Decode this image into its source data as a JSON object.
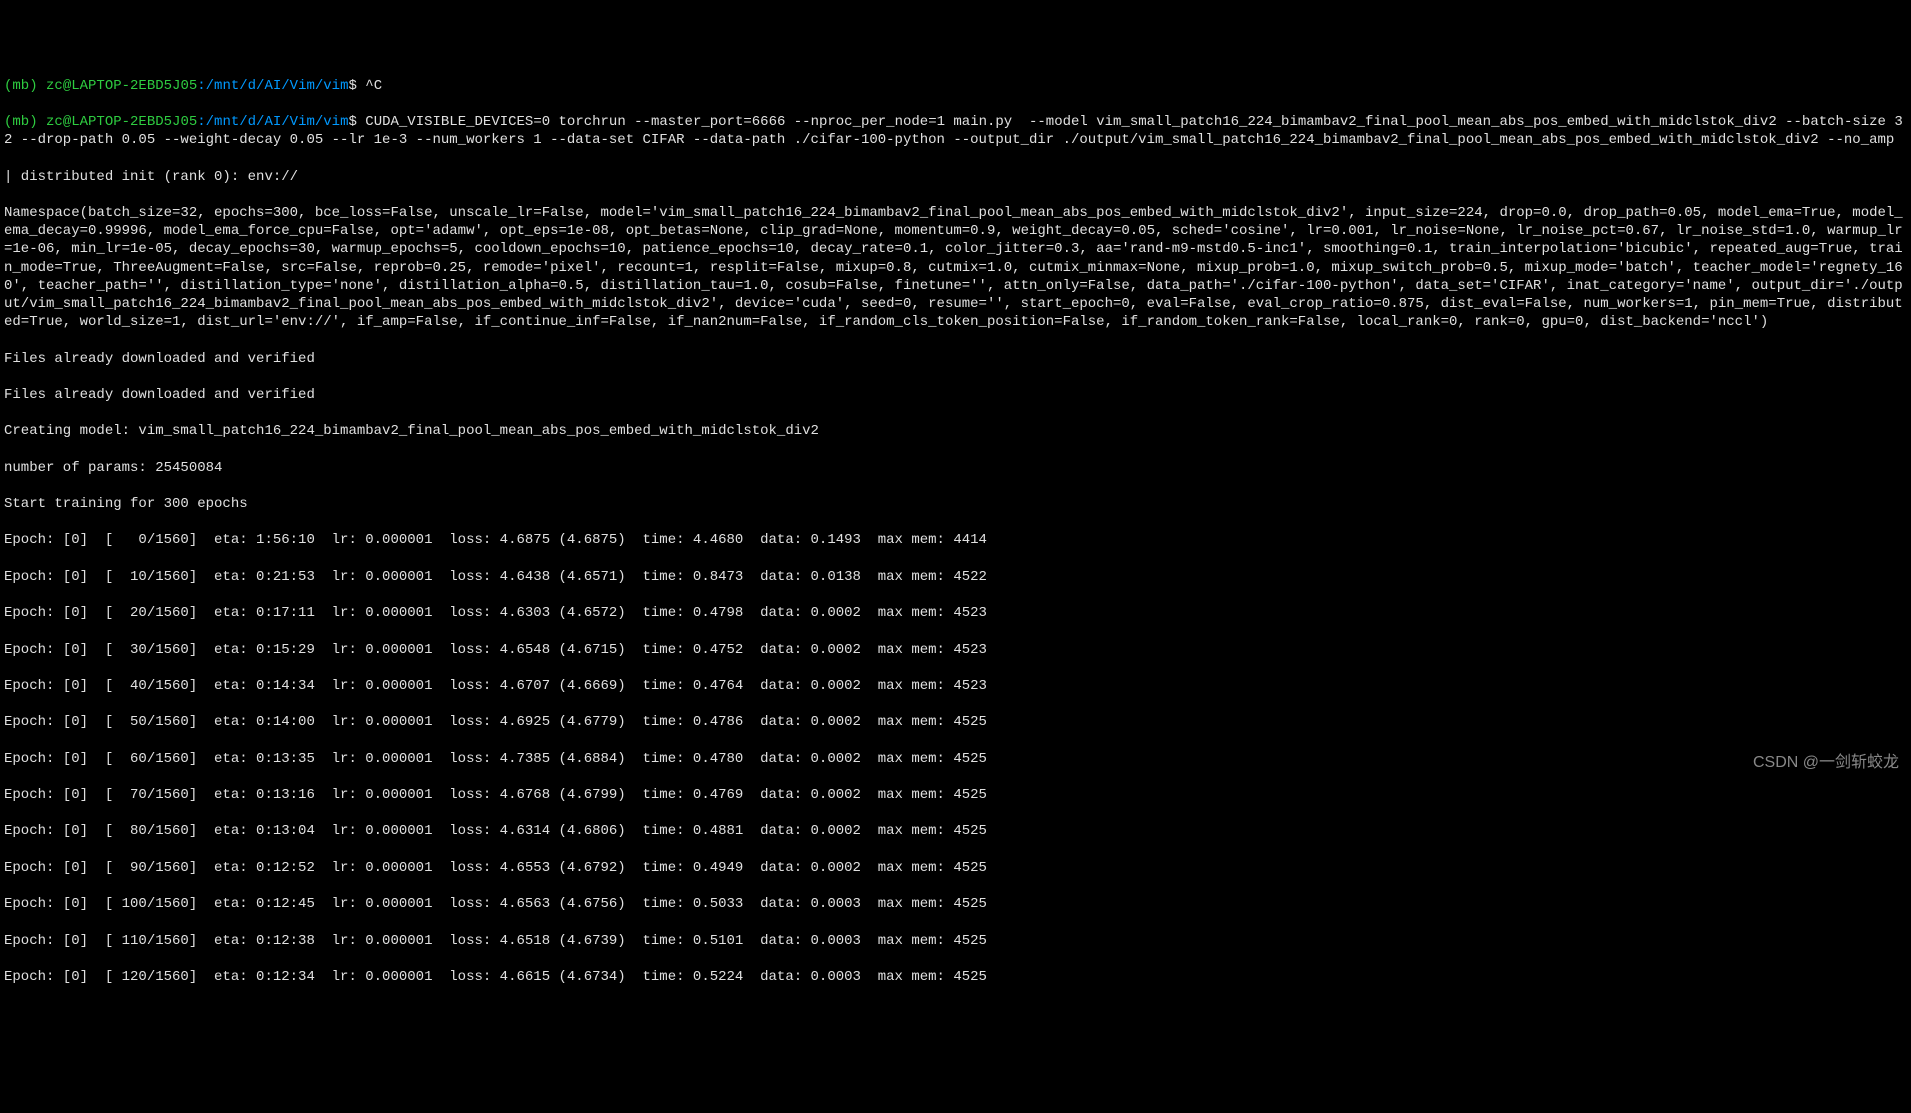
{
  "prompt1": {
    "env": "(mb)",
    "user": "zc@LAPTOP-2EBD5J05",
    "path": ":/mnt/d/AI/Vim/vim",
    "dollar": "$",
    "cmd": "^C"
  },
  "prompt2": {
    "env": "(mb)",
    "user": "zc@LAPTOP-2EBD5J05",
    "path": ":/mnt/d/AI/Vim/vim",
    "dollar": "$",
    "cmd": "CUDA_VISIBLE_DEVICES=0 torchrun --master_port=6666 --nproc_per_node=1 main.py  --model vim_small_patch16_224_bimambav2_final_pool_mean_abs_pos_embed_with_midclstok_div2 --batch-size 32 --drop-path 0.05 --weight-decay 0.05 --lr 1e-3 --num_workers 1 --data-set CIFAR --data-path ./cifar-100-python --output_dir ./output/vim_small_patch16_224_bimambav2_final_pool_mean_abs_pos_embed_with_midclstok_div2 --no_amp"
  },
  "dist_init": "| distributed init (rank 0): env://",
  "namespace": "Namespace(batch_size=32, epochs=300, bce_loss=False, unscale_lr=False, model='vim_small_patch16_224_bimambav2_final_pool_mean_abs_pos_embed_with_midclstok_div2', input_size=224, drop=0.0, drop_path=0.05, model_ema=True, model_ema_decay=0.99996, model_ema_force_cpu=False, opt='adamw', opt_eps=1e-08, opt_betas=None, clip_grad=None, momentum=0.9, weight_decay=0.05, sched='cosine', lr=0.001, lr_noise=None, lr_noise_pct=0.67, lr_noise_std=1.0, warmup_lr=1e-06, min_lr=1e-05, decay_epochs=30, warmup_epochs=5, cooldown_epochs=10, patience_epochs=10, decay_rate=0.1, color_jitter=0.3, aa='rand-m9-mstd0.5-inc1', smoothing=0.1, train_interpolation='bicubic', repeated_aug=True, train_mode=True, ThreeAugment=False, src=False, reprob=0.25, remode='pixel', recount=1, resplit=False, mixup=0.8, cutmix=1.0, cutmix_minmax=None, mixup_prob=1.0, mixup_switch_prob=0.5, mixup_mode='batch', teacher_model='regnety_160', teacher_path='', distillation_type='none', distillation_alpha=0.5, distillation_tau=1.0, cosub=False, finetune='', attn_only=False, data_path='./cifar-100-python', data_set='CIFAR', inat_category='name', output_dir='./output/vim_small_patch16_224_bimambav2_final_pool_mean_abs_pos_embed_with_midclstok_div2', device='cuda', seed=0, resume='', start_epoch=0, eval=False, eval_crop_ratio=0.875, dist_eval=False, num_workers=1, pin_mem=True, distributed=True, world_size=1, dist_url='env://', if_amp=False, if_continue_inf=False, if_nan2num=False, if_random_cls_token_position=False, if_random_token_rank=False, local_rank=0, rank=0, gpu=0, dist_backend='nccl')",
  "files1": "Files already downloaded and verified",
  "files2": "Files already downloaded and verified",
  "creating_model": "Creating model: vim_small_patch16_224_bimambav2_final_pool_mean_abs_pos_embed_with_midclstok_div2",
  "num_params": "number of params: 25450084",
  "start_training": "Start training for 300 epochs",
  "epochs": [
    "Epoch: [0]  [   0/1560]  eta: 1:56:10  lr: 0.000001  loss: 4.6875 (4.6875)  time: 4.4680  data: 0.1493  max mem: 4414",
    "Epoch: [0]  [  10/1560]  eta: 0:21:53  lr: 0.000001  loss: 4.6438 (4.6571)  time: 0.8473  data: 0.0138  max mem: 4522",
    "Epoch: [0]  [  20/1560]  eta: 0:17:11  lr: 0.000001  loss: 4.6303 (4.6572)  time: 0.4798  data: 0.0002  max mem: 4523",
    "Epoch: [0]  [  30/1560]  eta: 0:15:29  lr: 0.000001  loss: 4.6548 (4.6715)  time: 0.4752  data: 0.0002  max mem: 4523",
    "Epoch: [0]  [  40/1560]  eta: 0:14:34  lr: 0.000001  loss: 4.6707 (4.6669)  time: 0.4764  data: 0.0002  max mem: 4523",
    "Epoch: [0]  [  50/1560]  eta: 0:14:00  lr: 0.000001  loss: 4.6925 (4.6779)  time: 0.4786  data: 0.0002  max mem: 4525",
    "Epoch: [0]  [  60/1560]  eta: 0:13:35  lr: 0.000001  loss: 4.7385 (4.6884)  time: 0.4780  data: 0.0002  max mem: 4525",
    "Epoch: [0]  [  70/1560]  eta: 0:13:16  lr: 0.000001  loss: 4.6768 (4.6799)  time: 0.4769  data: 0.0002  max mem: 4525",
    "Epoch: [0]  [  80/1560]  eta: 0:13:04  lr: 0.000001  loss: 4.6314 (4.6806)  time: 0.4881  data: 0.0002  max mem: 4525",
    "Epoch: [0]  [  90/1560]  eta: 0:12:52  lr: 0.000001  loss: 4.6553 (4.6792)  time: 0.4949  data: 0.0002  max mem: 4525",
    "Epoch: [0]  [ 100/1560]  eta: 0:12:45  lr: 0.000001  loss: 4.6563 (4.6756)  time: 0.5033  data: 0.0003  max mem: 4525",
    "Epoch: [0]  [ 110/1560]  eta: 0:12:38  lr: 0.000001  loss: 4.6518 (4.6739)  time: 0.5101  data: 0.0003  max mem: 4525",
    "Epoch: [0]  [ 120/1560]  eta: 0:12:34  lr: 0.000001  loss: 4.6615 (4.6734)  time: 0.5224  data: 0.0003  max mem: 4525"
  ],
  "watermark": "CSDN @一剑斩蛟龙"
}
